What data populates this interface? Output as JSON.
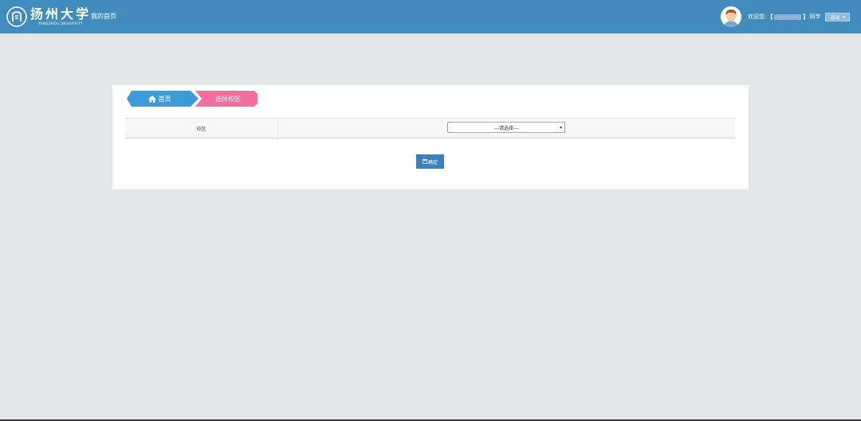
{
  "header": {
    "logo_cn": "扬州大学",
    "logo_en": "YANGZHOU UNIVERSITY",
    "nav_home": "我的首页",
    "welcome": "欢迎您:",
    "bracket_open": "【",
    "bracket_close": "】",
    "user_suffix": "同学",
    "logout_label": "退出",
    "logout_arrow": "➔"
  },
  "breadcrumb": {
    "home": "首页",
    "current": "选择校区"
  },
  "form": {
    "campus_label": "校区",
    "campus_select_value": "---请选择---",
    "confirm_label": "确定"
  },
  "colors": {
    "header_bg": "#428bbd",
    "crumb_home": "#3d9bd8",
    "crumb_current": "#f16e9e",
    "button": "#3b80b8"
  }
}
